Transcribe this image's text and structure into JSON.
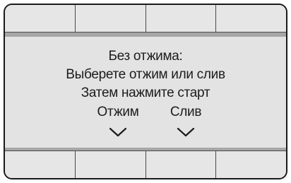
{
  "screen": {
    "title": "Без отжима:",
    "instruction_1": "Выберете отжим или слив",
    "instruction_2": "Затем нажмите старт"
  },
  "options": [
    {
      "label": "Отжим",
      "icon": "chevron-down-icon"
    },
    {
      "label": "Слив",
      "icon": "chevron-down-icon"
    }
  ],
  "colors": {
    "frame": "#1a1a1a",
    "key": "#e6e6e6",
    "band": "#a6a6a6",
    "display": "#e3e3e3",
    "text": "#1c1c1c"
  }
}
